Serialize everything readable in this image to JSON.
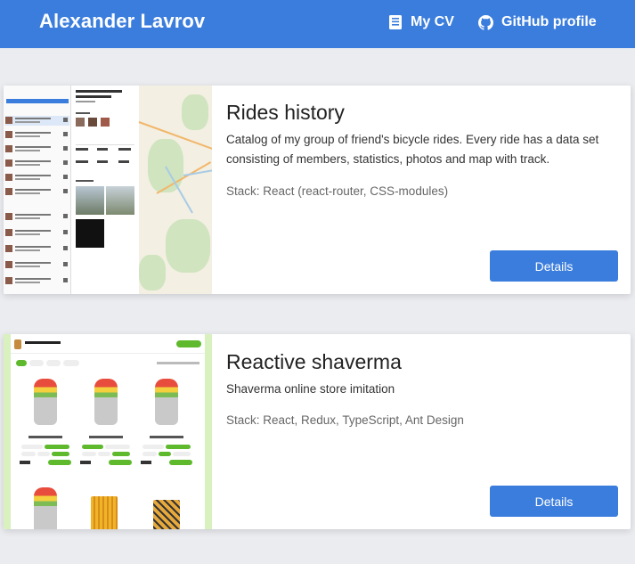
{
  "header": {
    "brand": "Alexander Lavrov",
    "nav": [
      {
        "label": "My CV",
        "icon": "document-icon"
      },
      {
        "label": "GitHub profile",
        "icon": "github-icon"
      }
    ]
  },
  "colors": {
    "accent": "#3b7ddd",
    "page_bg": "#ebecf0",
    "card_bg": "#ffffff"
  },
  "projects": [
    {
      "title": "Rides history",
      "description": "Catalog of my group of friend's bicycle rides. Every ride has a data set consisting of members, statistics, photos and map with track.",
      "stack": "Stack: React (react-router, CSS-modules)",
      "button": "Details"
    },
    {
      "title": "Reactive shaverma",
      "description": "Shaverma online store imitation",
      "stack": "Stack: React, Redux, TypeScript, Ant Design",
      "button": "Details"
    }
  ]
}
